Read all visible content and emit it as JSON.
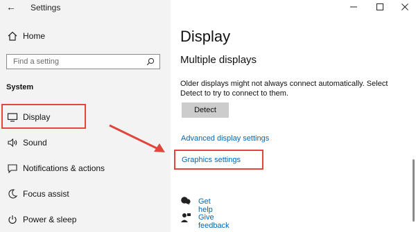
{
  "window": {
    "title": "Settings",
    "controls": [
      "minimize-icon",
      "maximize-icon",
      "close-icon"
    ]
  },
  "sidebar": {
    "home_label": "Home",
    "search": {
      "placeholder": "Find a setting"
    },
    "section_label": "System",
    "items": [
      {
        "label": "Display",
        "icon": "monitor-icon",
        "selected": true
      },
      {
        "label": "Sound",
        "icon": "speaker-icon"
      },
      {
        "label": "Notifications & actions",
        "icon": "message-icon"
      },
      {
        "label": "Focus assist",
        "icon": "moon-icon"
      },
      {
        "label": "Power & sleep",
        "icon": "power-icon"
      }
    ]
  },
  "main": {
    "page_title": "Display",
    "section_title": "Multiple displays",
    "description": "Older displays might not always connect automatically. Select Detect to try to connect to them.",
    "detect_button": "Detect",
    "links": {
      "advanced": "Advanced display settings",
      "graphics": "Graphics settings"
    },
    "help": [
      {
        "label": "Get help",
        "icon": "help-chat-icon"
      },
      {
        "label": "Give feedback",
        "icon": "feedback-icon"
      }
    ]
  },
  "annotation": {
    "highlight_color": "#e0463e",
    "arrow_color": "#e0463e"
  },
  "colors": {
    "sidebar_bg": "#f3f3f3",
    "link": "#0067b8",
    "button_bg": "#cccccc"
  }
}
